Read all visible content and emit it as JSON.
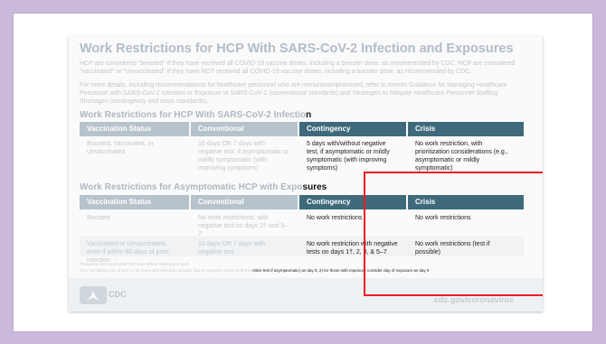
{
  "slide": {
    "title": "Work Restrictions for HCP With SARS-CoV-2 Infection and Exposures",
    "intro_1": "HCP are considered \"boosted\" if they have received all COVID-19 vaccine doses, including a booster dose, as recommended by CDC. HCP are considered \"vaccinated\" or \"unvaccinated\" if they have NOT received all COVID-19 vaccine doses, including a booster dose, as recommended by CDC.",
    "intro_2": "For more details, including recommendations for healthcare personnel who are immunocompromised, refer to Interim Guidance for Managing Healthcare Personnel with SARS-CoV-2 Infection or Exposure to SARS-CoV-2 (conventional standards) and Strategies to Mitigate Healthcare Personnel Staffing Shortages (contingency and crisis standards).",
    "section1_dim": "Work Restrictions for HCP With SARS-CoV-2 Infectio",
    "section1_hi": "n",
    "section2_dim": "Work Restrictions for Asymptomatic HCP with Expo",
    "section2_hi": "sures",
    "headers": {
      "vaccination": "Vaccination Status",
      "conventional": "Conventional",
      "contingency": "Contingency",
      "crisis": "Crisis"
    },
    "table1": {
      "status": "Boosted, Vaccinated, or Unvaccinated",
      "conventional": "10 days OR 7 days with negative test, if asymptomatic or mildly symptomatic (with improving symptoms)",
      "contingency": "5 days with/without negative test, if asymptomatic or mildly symptomatic (with improving symptoms)",
      "crisis": "No work restriction, with prioritization considerations (e.g., asymptomatic or mildly symptomatic)"
    },
    "table2": {
      "row1": {
        "status": "Boosted",
        "conventional": "No work restrictions, with negative test on days 2† and 5–7",
        "contingency": "No work restrictions",
        "crisis": "No work restrictions"
      },
      "row2": {
        "status": "Vaccinated or Unvaccinated, even if within 90 days of prior infection",
        "conventional": "10 days OR 7 days with negative test",
        "contingency": "No work restriction with negative tests on days 1†, 2, 3, & 5–7",
        "crisis": "No work restrictions (test if possible)"
      }
    },
    "footnote_1": "†Negative test result within 48 hours before returning to work",
    "footnote_2_dim": "‡For calculating day of test: 1) for those with infection consider day of symptom onset (or first po",
    "footnote_2_hi": "sitive test if asymptomatic) as day 0; 2) for those with exposure consider day of exposure as day 0",
    "logo_text": "CDC",
    "url": "cdc.gov/coronavirus"
  },
  "colors": {
    "frame_bg": "#cbb9dc",
    "header_dim": "#b7c3cb",
    "header_hi": "#3f6a7c",
    "highlight_border": "#ee1c24"
  }
}
